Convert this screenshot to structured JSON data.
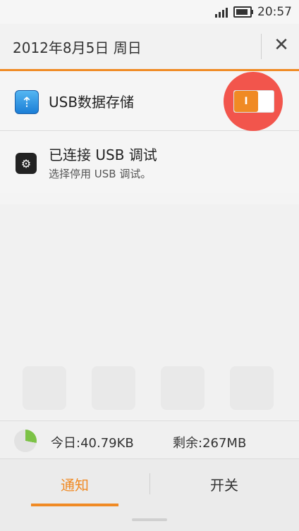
{
  "status_bar": {
    "time": "20:57",
    "icons": [
      "signal-icon",
      "battery-icon"
    ]
  },
  "header": {
    "date": "2012年8月5日 周日",
    "close_icon": "close-icon"
  },
  "notifications": {
    "usb_storage": {
      "icon": "usb-icon",
      "label": "USB数据存储",
      "toggle_on": true,
      "toggle_symbol": "I"
    },
    "usb_debug": {
      "icon": "android-debug-icon",
      "title": "已连接 USB 调试",
      "subtitle": "选择停用 USB 调试。"
    }
  },
  "data_usage": {
    "pie_fraction": 0.28,
    "today": "今日:40.79KB",
    "remaining": "剩余:267MB"
  },
  "tabs": [
    {
      "label": "通知",
      "active": true
    },
    {
      "label": "开关",
      "active": false
    }
  ],
  "colors": {
    "accent": "#f08a24",
    "highlight_circle": "#f2554c",
    "usb_icon_blue": "#1b7ed6",
    "pie_green": "#7cc246"
  }
}
